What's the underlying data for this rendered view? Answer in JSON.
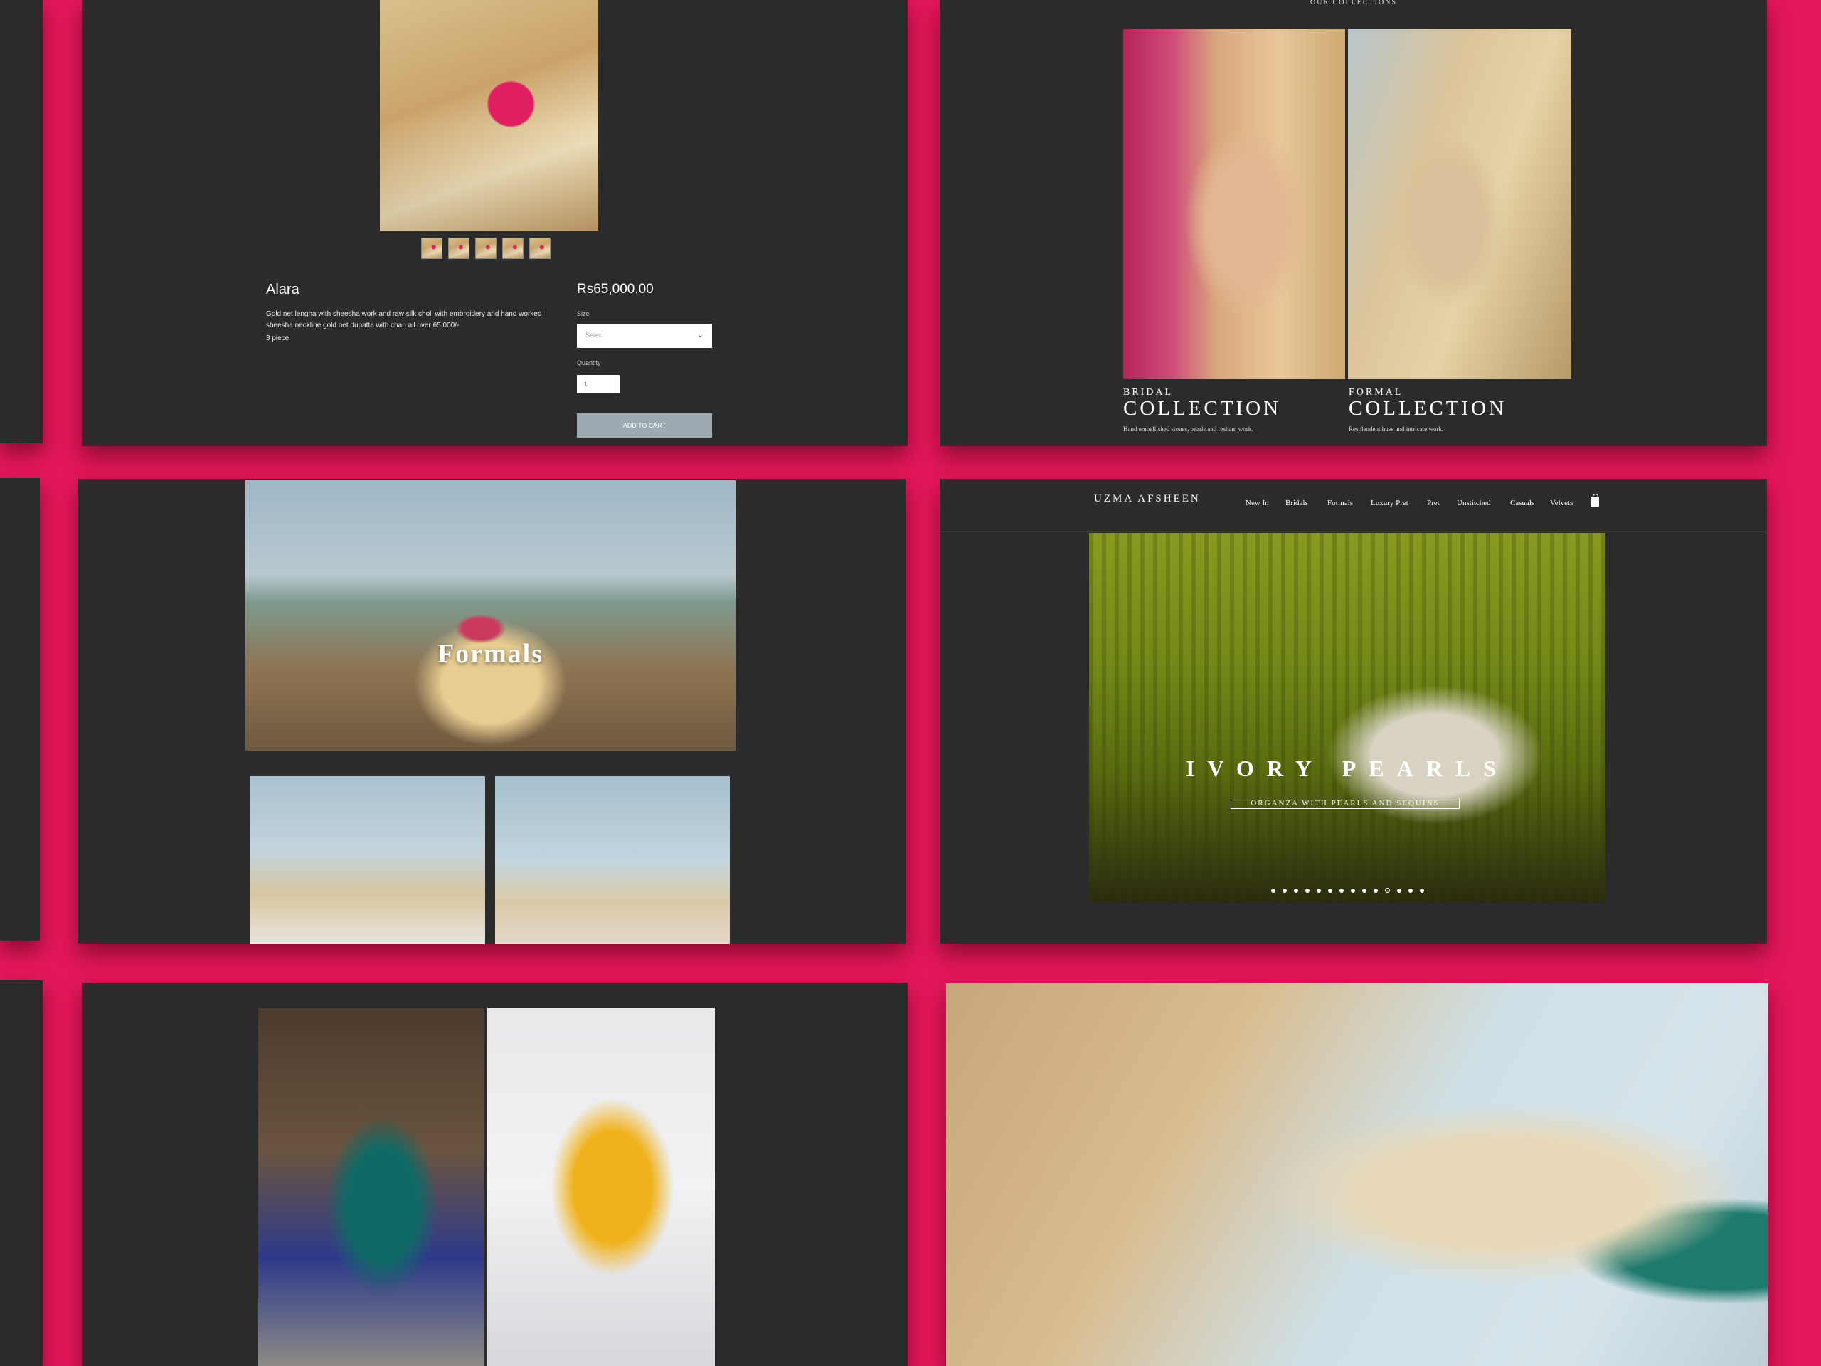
{
  "product": {
    "name": "Alara",
    "price": "Rs65,000.00",
    "description": "Gold net lengha with sheesha work and raw silk choli with embroidery and hand worked sheesha neckline gold net dupatta with chan all over 65,000/-",
    "pieces": "3 piece",
    "size_label": "Size",
    "size_placeholder": "Select",
    "quantity_label": "Quantity",
    "quantity_value": "1",
    "add_to_cart": "ADD TO CART"
  },
  "collections": {
    "heading": "OUR COLLECTIONS",
    "bridal": {
      "overline": "BRIDAL",
      "title": "COLLECTION",
      "caption": "Hand embellished stones, pearls and resham work."
    },
    "formal": {
      "overline": "FORMAL",
      "title": "COLLECTION",
      "caption": "Resplendent hues and intricate work."
    }
  },
  "formals_page": {
    "banner_title": "Formals"
  },
  "home": {
    "logo": "UZMA AFSHEEN",
    "nav": [
      "New In",
      "Bridals",
      "Formals",
      "Luxury Pret",
      "Pret",
      "Unstitched",
      "Casuals",
      "Velvets"
    ],
    "hero_title": "IVORY PEARLS",
    "hero_subtitle": "ORGANZA WITH PEARLS AND SEQUINS",
    "slide_count": 14,
    "active_slide": 10
  },
  "icons": {
    "cart": "shopping-bag-icon",
    "dropdown": "chevron-down-icon"
  },
  "colors": {
    "backdrop": "#e3175a",
    "panel": "#2b2b2b",
    "button": "#9eaab1"
  }
}
